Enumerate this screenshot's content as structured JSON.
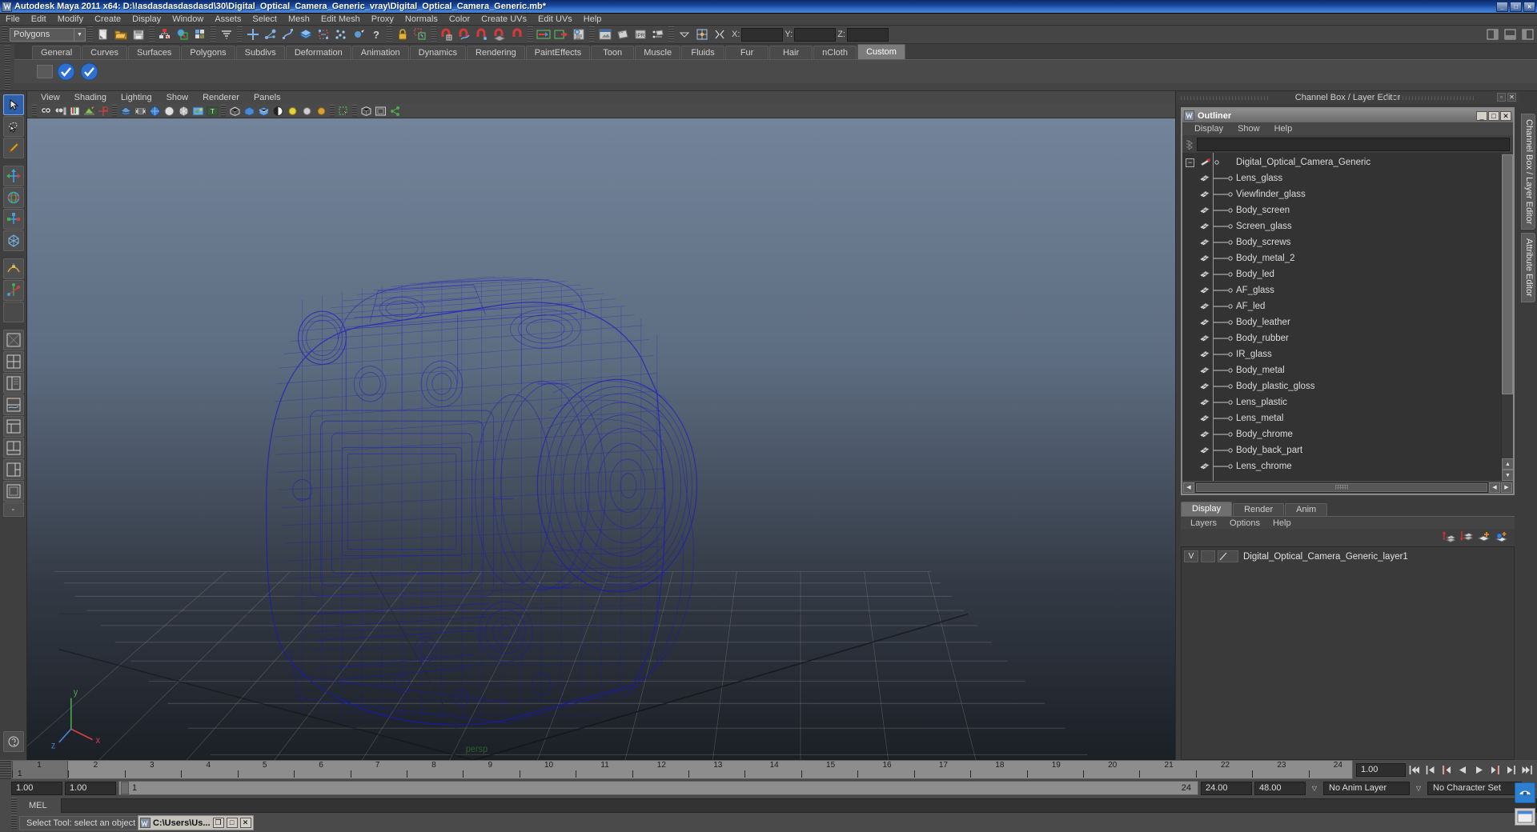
{
  "window": {
    "title": "Autodesk Maya 2011 x64: D:\\!asdasdasdasdasd\\30\\Digital_Optical_Camera_Generic_vray\\Digital_Optical_Camera_Generic.mb*",
    "app_icon": "maya-icon",
    "buttons": {
      "minimize": "_",
      "maximize": "□",
      "close": "×"
    }
  },
  "menubar": {
    "items": [
      "File",
      "Edit",
      "Modify",
      "Create",
      "Display",
      "Window",
      "Assets",
      "Select",
      "Mesh",
      "Edit Mesh",
      "Proxy",
      "Normals",
      "Color",
      "Create UVs",
      "Edit UVs",
      "Help"
    ]
  },
  "toolbar": {
    "selection_mode": "Polygons",
    "coords": {
      "x_label": "X:",
      "y_label": "Y:",
      "z_label": "Z:",
      "x_value": "",
      "y_value": "",
      "z_value": ""
    }
  },
  "shelf": {
    "tabs": [
      "General",
      "Curves",
      "Surfaces",
      "Polygons",
      "Subdivs",
      "Deformation",
      "Animation",
      "Dynamics",
      "Rendering",
      "PaintEffects",
      "Toon",
      "Muscle",
      "Fluids",
      "Fur",
      "Hair",
      "nCloth",
      "Custom"
    ],
    "active_tab": "Custom",
    "buttons": [
      "vray-check-icon",
      "vray-check-icon"
    ]
  },
  "viewport": {
    "menus": [
      "View",
      "Shading",
      "Lighting",
      "Show",
      "Renderer",
      "Panels"
    ],
    "axis_labels": {
      "y": "y",
      "x": "x",
      "z": "z"
    },
    "wireframe_color": "#1414c8",
    "bg_top": "#6e7f96",
    "bg_bottom": "#20242b"
  },
  "right_panel": {
    "header": "Channel Box / Layer Editor",
    "vertical_tabs": [
      "Channel Box / Layer Editor",
      "Attribute Editor"
    ]
  },
  "outliner": {
    "title": "Outliner",
    "window_buttons": [
      "_",
      "□",
      "✕"
    ],
    "menus": [
      "Display",
      "Show",
      "Help"
    ],
    "search_value": "",
    "root": {
      "label": "Digital_Optical_Camera_Generic",
      "icon": "transform-icon",
      "expanded": true
    },
    "children": [
      "Lens_glass",
      "Viewfinder_glass",
      "Body_screen",
      "Screen_glass",
      "Body_screws",
      "Body_metal_2",
      "Body_led",
      "AF_glass",
      "AF_led",
      "Body_leather",
      "Body_rubber",
      "IR_glass",
      "Body_metal",
      "Body_plastic_gloss",
      "Lens_plastic",
      "Lens_metal",
      "Body_chrome",
      "Body_back_part",
      "Lens_chrome"
    ]
  },
  "layer_editor": {
    "tabs": [
      "Display",
      "Render",
      "Anim"
    ],
    "active_tab": "Display",
    "menus": [
      "Layers",
      "Options",
      "Help"
    ],
    "tool_icons": [
      "move-layer-up-icon",
      "move-layer-down-icon",
      "new-layer-icon",
      "new-layer-from-selected-icon"
    ],
    "layers": [
      {
        "visibility": "V",
        "state": "",
        "color": "",
        "name": "Digital_Optical_Camera_Generic_layer1"
      }
    ]
  },
  "timeline": {
    "ticks": [
      "1",
      "2",
      "3",
      "4",
      "5",
      "6",
      "7",
      "8",
      "9",
      "10",
      "11",
      "12",
      "13",
      "14",
      "15",
      "16",
      "17",
      "18",
      "19",
      "20",
      "21",
      "22",
      "23",
      "24"
    ],
    "current_frame_label": "1",
    "current_time_field": "1.00",
    "playback_buttons": [
      "go-to-start-icon",
      "step-back-keyframe-icon",
      "step-back-frame-icon",
      "play-backwards-icon",
      "play-forwards-icon",
      "step-forward-frame-icon",
      "step-forward-keyframe-icon",
      "go-to-end-icon"
    ]
  },
  "range_slider": {
    "start": "1.00",
    "end": "1.00",
    "range_start_label": "1",
    "range_end_label": "24",
    "anim_end": "24.00",
    "playback_end": "48.00",
    "anim_layer": "No Anim Layer",
    "character_set": "No Character Set"
  },
  "command_line": {
    "language": "MEL",
    "value": ""
  },
  "status_bar": {
    "help_text": "Select Tool: select an object",
    "taskbar_button": {
      "title": "C:\\Users\\Us...",
      "buttons": [
        "❐",
        "□",
        "✕"
      ]
    }
  }
}
